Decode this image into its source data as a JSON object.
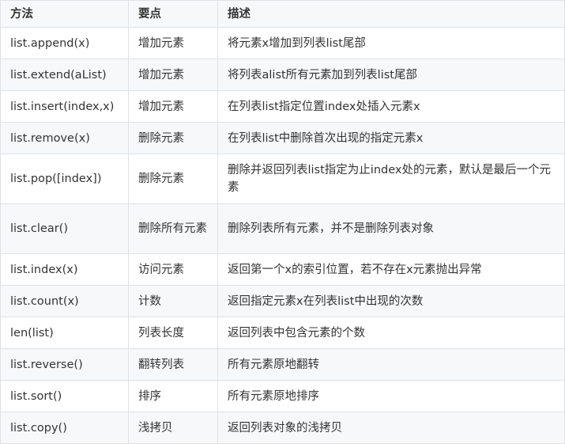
{
  "table": {
    "headers": [
      "方法",
      "要点",
      "描述"
    ],
    "rows": [
      {
        "method": "list.append(x)",
        "key": "增加元素",
        "desc": "将元素x增加到列表list尾部"
      },
      {
        "method": "list.extend(aList)",
        "key": "增加元素",
        "desc": "将列表alist所有元素加到列表list尾部"
      },
      {
        "method": "list.insert(index,x)",
        "key": "增加元素",
        "desc": "在列表list指定位置index处插入元素x"
      },
      {
        "method": "list.remove(x)",
        "key": "删除元素",
        "desc": "在列表list中删除首次出现的指定元素x"
      },
      {
        "method": "list.pop([index])",
        "key": "删除元素",
        "desc": "删除并返回列表list指定为止index处的元素，默认是最后一个元素"
      },
      {
        "method": "list.clear()",
        "key": "删除所有元素",
        "desc": "删除列表所有元素，并不是删除列表对象"
      },
      {
        "method": "list.index(x)",
        "key": "访问元素",
        "desc": "返回第一个x的索引位置，若不存在x元素抛出异常"
      },
      {
        "method": "list.count(x)",
        "key": "计数",
        "desc": "返回指定元素x在列表list中出现的次数"
      },
      {
        "method": "len(list)",
        "key": "列表长度",
        "desc": "返回列表中包含元素的个数"
      },
      {
        "method": "list.reverse()",
        "key": "翻转列表",
        "desc": "所有元素原地翻转"
      },
      {
        "method": "list.sort()",
        "key": "排序",
        "desc": "所有元素原地排序"
      },
      {
        "method": "list.copy()",
        "key": "浅拷贝",
        "desc": "返回列表对象的浅拷贝"
      }
    ]
  }
}
